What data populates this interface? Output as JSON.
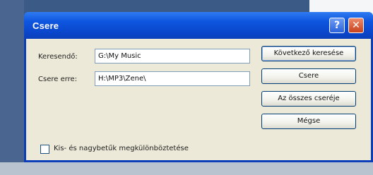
{
  "window": {
    "title": "Csere",
    "help_glyph": "?",
    "close_glyph": "✕"
  },
  "form": {
    "search_in_label": "Keresendő:",
    "search_in_value": "G:\\My Music",
    "replace_with_label": "Csere erre:",
    "replace_with_value": "H:\\MP3\\Zene\\"
  },
  "buttons": {
    "find_next": "Következő keresése",
    "replace": "Csere",
    "replace_all": "Az összes cseréje",
    "cancel": "Mégse"
  },
  "options": {
    "match_case_label": "Kis- és nagybetűk megkülönböztetése",
    "match_case_checked": false
  },
  "colors": {
    "titlebar": "#0a47cc",
    "client": "#ece9d8"
  }
}
